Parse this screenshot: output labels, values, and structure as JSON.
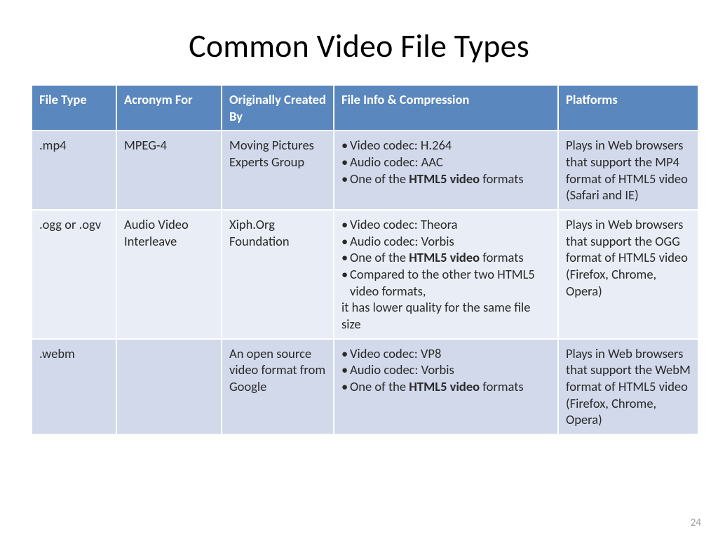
{
  "title": "Common Video File Types",
  "page_number": "24",
  "columns": {
    "file_type": "File Type",
    "acronym": "Acronym For",
    "originally": "Originally Created By",
    "file_info": "File Info & Compression",
    "platforms": "Platforms"
  },
  "rows": [
    {
      "file_type": ".mp4",
      "acronym": "MPEG-4",
      "originally": "Moving Pictures Experts Group",
      "info_bullets": [
        {
          "pre": "Video codec: H.264"
        },
        {
          "pre": "Audio codec: AAC"
        },
        {
          "pre": "One of the ",
          "bold": "HTML5 video",
          "post": " formats"
        }
      ],
      "info_extra": "",
      "platforms": "Plays in Web browsers that support the MP4 format of HTML5 video (Safari and IE)"
    },
    {
      "file_type": ".ogg or .ogv",
      "acronym": "Audio Video Interleave",
      "originally": "Xiph.Org Foundation",
      "info_bullets": [
        {
          "pre": "Video codec: Theora"
        },
        {
          "pre": "Audio codec: Vorbis"
        },
        {
          "pre": "One of the ",
          "bold": "HTML5 video",
          "post": " formats"
        },
        {
          "pre": "Compared to the other two HTML5 video formats,"
        }
      ],
      "info_extra": "it has lower quality for the same file size",
      "platforms": "Plays in Web browsers that support the OGG format of HTML5 video (Firefox, Chrome, Opera)"
    },
    {
      "file_type": ".webm",
      "acronym": "",
      "originally": "An open source video format from Google",
      "info_bullets": [
        {
          "pre": "Video codec: VP8"
        },
        {
          "pre": "Audio codec: Vorbis"
        },
        {
          "pre": "One of the ",
          "bold": "HTML5 video",
          "post": " formats"
        }
      ],
      "info_extra": "",
      "platforms": "Plays in Web browsers that support the WebM format of HTML5 video (Firefox, Chrome, Opera)"
    }
  ]
}
